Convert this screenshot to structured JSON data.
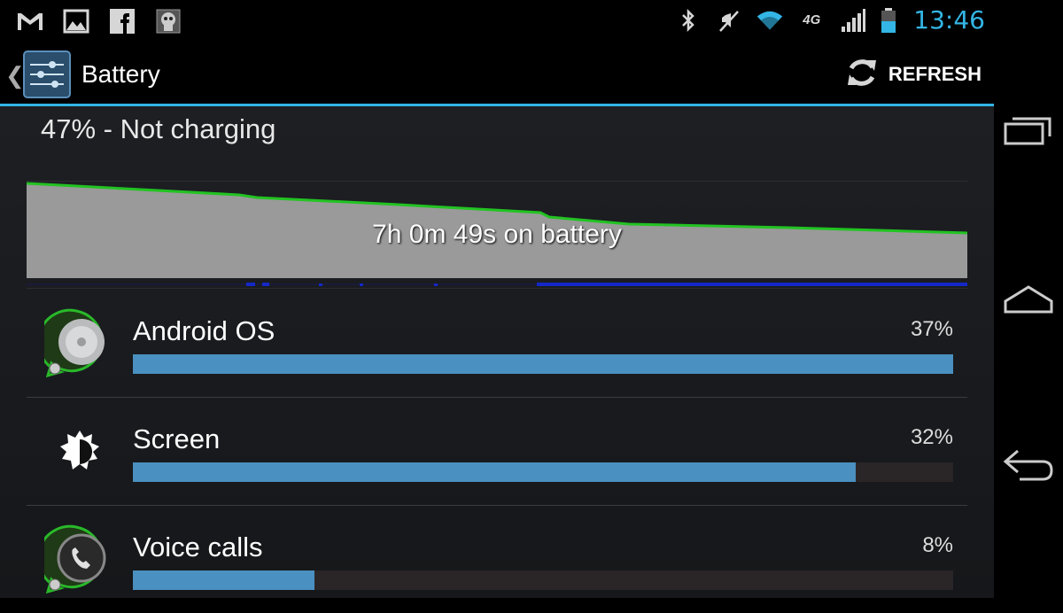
{
  "status_bar": {
    "left_icons": [
      "gmail-icon",
      "gallery-icon",
      "facebook-icon",
      "ghost-icon"
    ],
    "right_icons": [
      "bluetooth-icon",
      "vibrate-icon",
      "wifi-icon",
      "4g-lte-icon",
      "signal-icon",
      "battery-icon"
    ],
    "network_label": "4G",
    "time": "13:46"
  },
  "action_bar": {
    "title": "Battery",
    "refresh_label": "REFRESH",
    "icons": [
      "back-caret-icon",
      "settings-sliders-icon",
      "refresh-icon"
    ]
  },
  "battery": {
    "status": "47% - Not charging",
    "graph_label": "7h 0m 49s on battery",
    "level_start_pct": 100,
    "level_end_pct": 47
  },
  "usage": [
    {
      "name": "Android OS",
      "percent_label": "37%",
      "fill": 1.0,
      "icon": "android-os-icon"
    },
    {
      "name": "Screen",
      "percent_label": "32%",
      "fill": 0.881,
      "icon": "brightness-icon"
    },
    {
      "name": "Voice calls",
      "percent_label": "8%",
      "fill": 0.221,
      "icon": "phone-call-icon"
    }
  ],
  "navigation": [
    "recent-apps-icon",
    "home-icon",
    "back-icon"
  ],
  "colors": {
    "accent": "#33b5e5",
    "bar": "#4a90c0",
    "graph_line": "#22c322",
    "graph_fill": "#999999",
    "awake": "#1428c8"
  }
}
